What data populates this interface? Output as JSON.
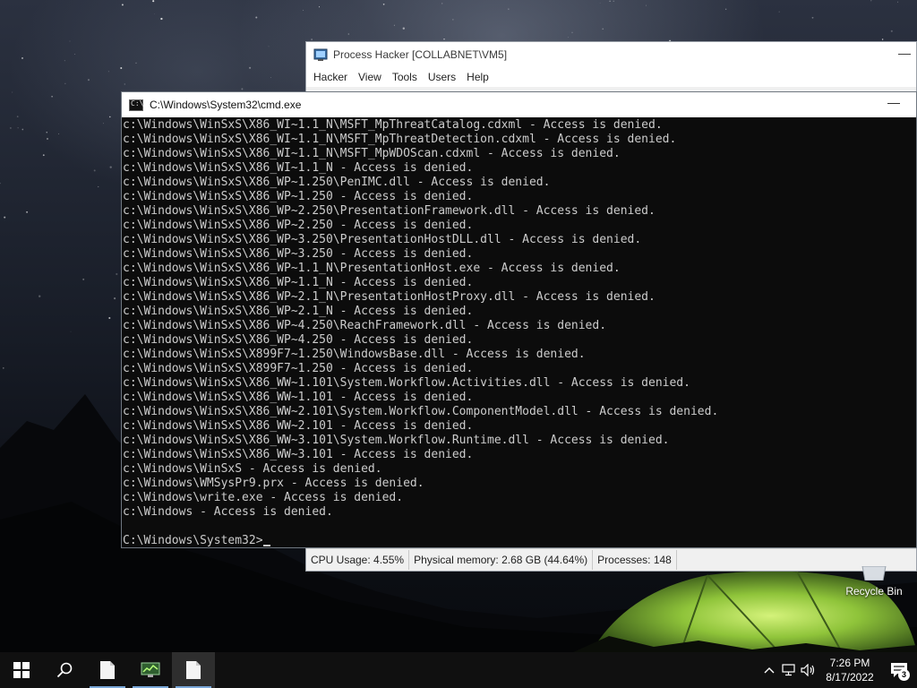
{
  "process_hacker": {
    "title": "Process Hacker [COLLABNET\\VM5]",
    "menu": [
      "Hacker",
      "View",
      "Tools",
      "Users",
      "Help"
    ],
    "status": {
      "cpu": "CPU Usage: 4.55%",
      "memory": "Physical memory: 2.68 GB (44.64%)",
      "processes": "Processes: 148"
    }
  },
  "cmd": {
    "title": "C:\\Windows\\System32\\cmd.exe",
    "lines": [
      "c:\\Windows\\WinSxS\\X86_WI~1.1_N\\MSFT_MpThreatCatalog.cdxml - Access is denied.",
      "c:\\Windows\\WinSxS\\X86_WI~1.1_N\\MSFT_MpThreatDetection.cdxml - Access is denied.",
      "c:\\Windows\\WinSxS\\X86_WI~1.1_N\\MSFT_MpWDOScan.cdxml - Access is denied.",
      "c:\\Windows\\WinSxS\\X86_WI~1.1_N - Access is denied.",
      "c:\\Windows\\WinSxS\\X86_WP~1.250\\PenIMC.dll - Access is denied.",
      "c:\\Windows\\WinSxS\\X86_WP~1.250 - Access is denied.",
      "c:\\Windows\\WinSxS\\X86_WP~2.250\\PresentationFramework.dll - Access is denied.",
      "c:\\Windows\\WinSxS\\X86_WP~2.250 - Access is denied.",
      "c:\\Windows\\WinSxS\\X86_WP~3.250\\PresentationHostDLL.dll - Access is denied.",
      "c:\\Windows\\WinSxS\\X86_WP~3.250 - Access is denied.",
      "c:\\Windows\\WinSxS\\X86_WP~1.1_N\\PresentationHost.exe - Access is denied.",
      "c:\\Windows\\WinSxS\\X86_WP~1.1_N - Access is denied.",
      "c:\\Windows\\WinSxS\\X86_WP~2.1_N\\PresentationHostProxy.dll - Access is denied.",
      "c:\\Windows\\WinSxS\\X86_WP~2.1_N - Access is denied.",
      "c:\\Windows\\WinSxS\\X86_WP~4.250\\ReachFramework.dll - Access is denied.",
      "c:\\Windows\\WinSxS\\X86_WP~4.250 - Access is denied.",
      "c:\\Windows\\WinSxS\\X899F7~1.250\\WindowsBase.dll - Access is denied.",
      "c:\\Windows\\WinSxS\\X899F7~1.250 - Access is denied.",
      "c:\\Windows\\WinSxS\\X86_WW~1.101\\System.Workflow.Activities.dll - Access is denied.",
      "c:\\Windows\\WinSxS\\X86_WW~1.101 - Access is denied.",
      "c:\\Windows\\WinSxS\\X86_WW~2.101\\System.Workflow.ComponentModel.dll - Access is denied.",
      "c:\\Windows\\WinSxS\\X86_WW~2.101 - Access is denied.",
      "c:\\Windows\\WinSxS\\X86_WW~3.101\\System.Workflow.Runtime.dll - Access is denied.",
      "c:\\Windows\\WinSxS\\X86_WW~3.101 - Access is denied.",
      "c:\\Windows\\WinSxS - Access is denied.",
      "c:\\Windows\\WMSysPr9.prx - Access is denied.",
      "c:\\Windows\\write.exe - Access is denied.",
      "c:\\Windows - Access is denied."
    ],
    "prompt": "C:\\Windows\\System32>"
  },
  "desktop": {
    "recycle_bin_label": "Recycle Bin"
  },
  "taskbar": {
    "icons": [
      "windows-start-icon",
      "search-icon",
      "file-icon",
      "process-hacker-icon",
      "file-icon"
    ],
    "time": "7:26 PM",
    "date": "8/17/2022",
    "notification_count": "3"
  }
}
